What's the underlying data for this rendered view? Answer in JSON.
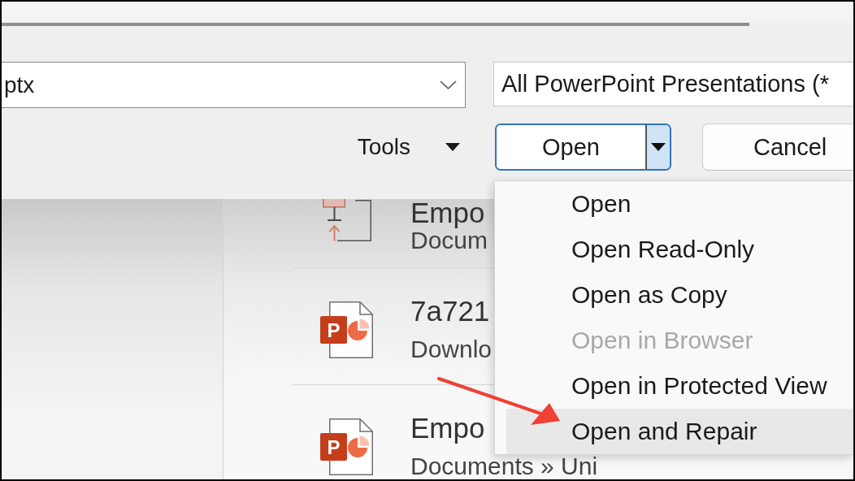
{
  "file_name_field": {
    "value": "ptx"
  },
  "file_type_filter": {
    "value": "All PowerPoint Presentations (*"
  },
  "tools_button": {
    "label": "Tools"
  },
  "open_button": {
    "label": "Open",
    "expanded": true,
    "menu": [
      {
        "label": "Open",
        "disabled": false,
        "highlighted": false,
        "annotated": false
      },
      {
        "label": "Open Read-Only",
        "disabled": false,
        "highlighted": false,
        "annotated": false
      },
      {
        "label": "Open as Copy",
        "disabled": false,
        "highlighted": false,
        "annotated": false
      },
      {
        "label": "Open in Browser",
        "disabled": true,
        "highlighted": false,
        "annotated": false
      },
      {
        "label": "Open in Protected View",
        "disabled": false,
        "highlighted": false,
        "annotated": false
      },
      {
        "label": "Open and Repair",
        "disabled": false,
        "highlighted": true,
        "annotated": true
      }
    ]
  },
  "cancel_button": {
    "label": "Cancel"
  },
  "file_list": [
    {
      "kind": "document",
      "title": "Empo",
      "location": "Docum"
    },
    {
      "kind": "presentation",
      "badge": "P",
      "title": "7a721",
      "location": "Downlo"
    },
    {
      "kind": "presentation",
      "badge": "P",
      "title": "Empo",
      "location": "Documents » Uni"
    }
  ]
}
